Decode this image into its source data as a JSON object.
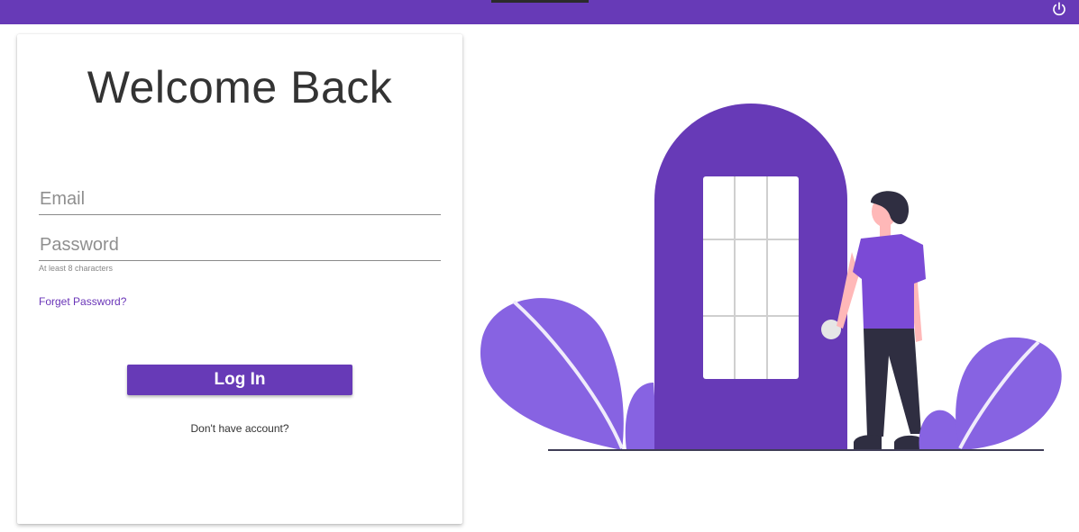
{
  "topbar": {
    "icons": {
      "power": "power-icon"
    }
  },
  "login": {
    "title": "Welcome Back",
    "email_placeholder": "Email",
    "password_placeholder": "Password",
    "password_hint": "At least 8 characters",
    "forgot_label": "Forget Password?",
    "submit_label": "Log In",
    "signup_prompt": "Don't have account?"
  },
  "theme": {
    "primary": "#673ab7",
    "accent_light": "#8763e2",
    "dark": "#2f2e41",
    "skin": "#ffb8b8"
  }
}
